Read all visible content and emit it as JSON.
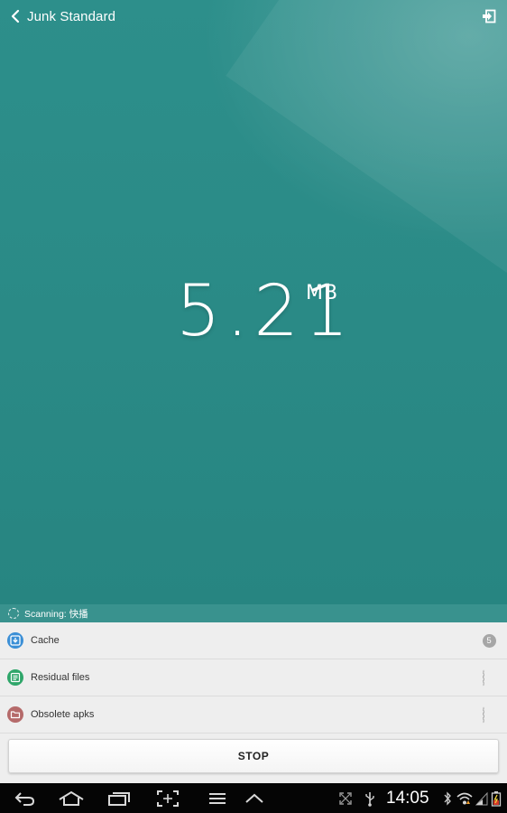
{
  "header": {
    "title": "Junk Standard",
    "back_icon": "chevron-left-icon",
    "exit_icon": "exit-icon"
  },
  "scan_result": {
    "size_value": "5.21",
    "size_unit": "MB"
  },
  "scan_status": {
    "text": "Scanning: 快播"
  },
  "categories": [
    {
      "label": "Cache",
      "icon": "cache-download-icon",
      "icon_color": "#3b8fd6",
      "count": "5",
      "state": "done"
    },
    {
      "label": "Residual files",
      "icon": "residual-files-icon",
      "icon_color": "#2fa66a",
      "state": "scanning"
    },
    {
      "label": "Obsolete apks",
      "icon": "folder-icon",
      "icon_color": "#b56a6a",
      "state": "scanning"
    }
  ],
  "actions": {
    "stop_label": "STOP"
  },
  "system_bar": {
    "time": "14:05",
    "nav_icons": [
      "back-icon",
      "home-icon",
      "recent-apps-icon",
      "screenshot-icon",
      "menu-icon",
      "up-chevron-icon"
    ],
    "status_icons": [
      "expand-icon",
      "usb-icon",
      "bluetooth-icon",
      "wifi-icon",
      "signal-icon",
      "battery-icon"
    ]
  },
  "colors": {
    "hero_bg": "#2a8a86",
    "accent_cache": "#3b8fd6",
    "accent_residual": "#2fa66a",
    "accent_apks": "#b56a6a"
  }
}
